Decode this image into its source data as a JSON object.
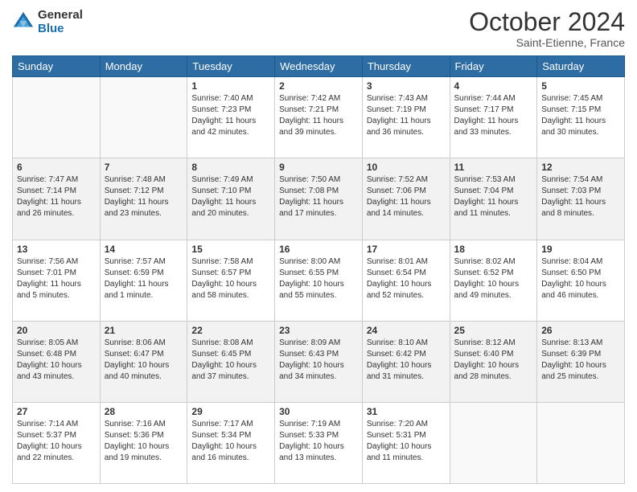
{
  "header": {
    "logo_general": "General",
    "logo_blue": "Blue",
    "month_year": "October 2024",
    "location": "Saint-Etienne, France"
  },
  "days_of_week": [
    "Sunday",
    "Monday",
    "Tuesday",
    "Wednesday",
    "Thursday",
    "Friday",
    "Saturday"
  ],
  "weeks": [
    [
      {
        "num": "",
        "sunrise": "",
        "sunset": "",
        "daylight": ""
      },
      {
        "num": "",
        "sunrise": "",
        "sunset": "",
        "daylight": ""
      },
      {
        "num": "1",
        "sunrise": "Sunrise: 7:40 AM",
        "sunset": "Sunset: 7:23 PM",
        "daylight": "Daylight: 11 hours and 42 minutes."
      },
      {
        "num": "2",
        "sunrise": "Sunrise: 7:42 AM",
        "sunset": "Sunset: 7:21 PM",
        "daylight": "Daylight: 11 hours and 39 minutes."
      },
      {
        "num": "3",
        "sunrise": "Sunrise: 7:43 AM",
        "sunset": "Sunset: 7:19 PM",
        "daylight": "Daylight: 11 hours and 36 minutes."
      },
      {
        "num": "4",
        "sunrise": "Sunrise: 7:44 AM",
        "sunset": "Sunset: 7:17 PM",
        "daylight": "Daylight: 11 hours and 33 minutes."
      },
      {
        "num": "5",
        "sunrise": "Sunrise: 7:45 AM",
        "sunset": "Sunset: 7:15 PM",
        "daylight": "Daylight: 11 hours and 30 minutes."
      }
    ],
    [
      {
        "num": "6",
        "sunrise": "Sunrise: 7:47 AM",
        "sunset": "Sunset: 7:14 PM",
        "daylight": "Daylight: 11 hours and 26 minutes."
      },
      {
        "num": "7",
        "sunrise": "Sunrise: 7:48 AM",
        "sunset": "Sunset: 7:12 PM",
        "daylight": "Daylight: 11 hours and 23 minutes."
      },
      {
        "num": "8",
        "sunrise": "Sunrise: 7:49 AM",
        "sunset": "Sunset: 7:10 PM",
        "daylight": "Daylight: 11 hours and 20 minutes."
      },
      {
        "num": "9",
        "sunrise": "Sunrise: 7:50 AM",
        "sunset": "Sunset: 7:08 PM",
        "daylight": "Daylight: 11 hours and 17 minutes."
      },
      {
        "num": "10",
        "sunrise": "Sunrise: 7:52 AM",
        "sunset": "Sunset: 7:06 PM",
        "daylight": "Daylight: 11 hours and 14 minutes."
      },
      {
        "num": "11",
        "sunrise": "Sunrise: 7:53 AM",
        "sunset": "Sunset: 7:04 PM",
        "daylight": "Daylight: 11 hours and 11 minutes."
      },
      {
        "num": "12",
        "sunrise": "Sunrise: 7:54 AM",
        "sunset": "Sunset: 7:03 PM",
        "daylight": "Daylight: 11 hours and 8 minutes."
      }
    ],
    [
      {
        "num": "13",
        "sunrise": "Sunrise: 7:56 AM",
        "sunset": "Sunset: 7:01 PM",
        "daylight": "Daylight: 11 hours and 5 minutes."
      },
      {
        "num": "14",
        "sunrise": "Sunrise: 7:57 AM",
        "sunset": "Sunset: 6:59 PM",
        "daylight": "Daylight: 11 hours and 1 minute."
      },
      {
        "num": "15",
        "sunrise": "Sunrise: 7:58 AM",
        "sunset": "Sunset: 6:57 PM",
        "daylight": "Daylight: 10 hours and 58 minutes."
      },
      {
        "num": "16",
        "sunrise": "Sunrise: 8:00 AM",
        "sunset": "Sunset: 6:55 PM",
        "daylight": "Daylight: 10 hours and 55 minutes."
      },
      {
        "num": "17",
        "sunrise": "Sunrise: 8:01 AM",
        "sunset": "Sunset: 6:54 PM",
        "daylight": "Daylight: 10 hours and 52 minutes."
      },
      {
        "num": "18",
        "sunrise": "Sunrise: 8:02 AM",
        "sunset": "Sunset: 6:52 PM",
        "daylight": "Daylight: 10 hours and 49 minutes."
      },
      {
        "num": "19",
        "sunrise": "Sunrise: 8:04 AM",
        "sunset": "Sunset: 6:50 PM",
        "daylight": "Daylight: 10 hours and 46 minutes."
      }
    ],
    [
      {
        "num": "20",
        "sunrise": "Sunrise: 8:05 AM",
        "sunset": "Sunset: 6:48 PM",
        "daylight": "Daylight: 10 hours and 43 minutes."
      },
      {
        "num": "21",
        "sunrise": "Sunrise: 8:06 AM",
        "sunset": "Sunset: 6:47 PM",
        "daylight": "Daylight: 10 hours and 40 minutes."
      },
      {
        "num": "22",
        "sunrise": "Sunrise: 8:08 AM",
        "sunset": "Sunset: 6:45 PM",
        "daylight": "Daylight: 10 hours and 37 minutes."
      },
      {
        "num": "23",
        "sunrise": "Sunrise: 8:09 AM",
        "sunset": "Sunset: 6:43 PM",
        "daylight": "Daylight: 10 hours and 34 minutes."
      },
      {
        "num": "24",
        "sunrise": "Sunrise: 8:10 AM",
        "sunset": "Sunset: 6:42 PM",
        "daylight": "Daylight: 10 hours and 31 minutes."
      },
      {
        "num": "25",
        "sunrise": "Sunrise: 8:12 AM",
        "sunset": "Sunset: 6:40 PM",
        "daylight": "Daylight: 10 hours and 28 minutes."
      },
      {
        "num": "26",
        "sunrise": "Sunrise: 8:13 AM",
        "sunset": "Sunset: 6:39 PM",
        "daylight": "Daylight: 10 hours and 25 minutes."
      }
    ],
    [
      {
        "num": "27",
        "sunrise": "Sunrise: 7:14 AM",
        "sunset": "Sunset: 5:37 PM",
        "daylight": "Daylight: 10 hours and 22 minutes."
      },
      {
        "num": "28",
        "sunrise": "Sunrise: 7:16 AM",
        "sunset": "Sunset: 5:36 PM",
        "daylight": "Daylight: 10 hours and 19 minutes."
      },
      {
        "num": "29",
        "sunrise": "Sunrise: 7:17 AM",
        "sunset": "Sunset: 5:34 PM",
        "daylight": "Daylight: 10 hours and 16 minutes."
      },
      {
        "num": "30",
        "sunrise": "Sunrise: 7:19 AM",
        "sunset": "Sunset: 5:33 PM",
        "daylight": "Daylight: 10 hours and 13 minutes."
      },
      {
        "num": "31",
        "sunrise": "Sunrise: 7:20 AM",
        "sunset": "Sunset: 5:31 PM",
        "daylight": "Daylight: 10 hours and 11 minutes."
      },
      {
        "num": "",
        "sunrise": "",
        "sunset": "",
        "daylight": ""
      },
      {
        "num": "",
        "sunrise": "",
        "sunset": "",
        "daylight": ""
      }
    ]
  ]
}
